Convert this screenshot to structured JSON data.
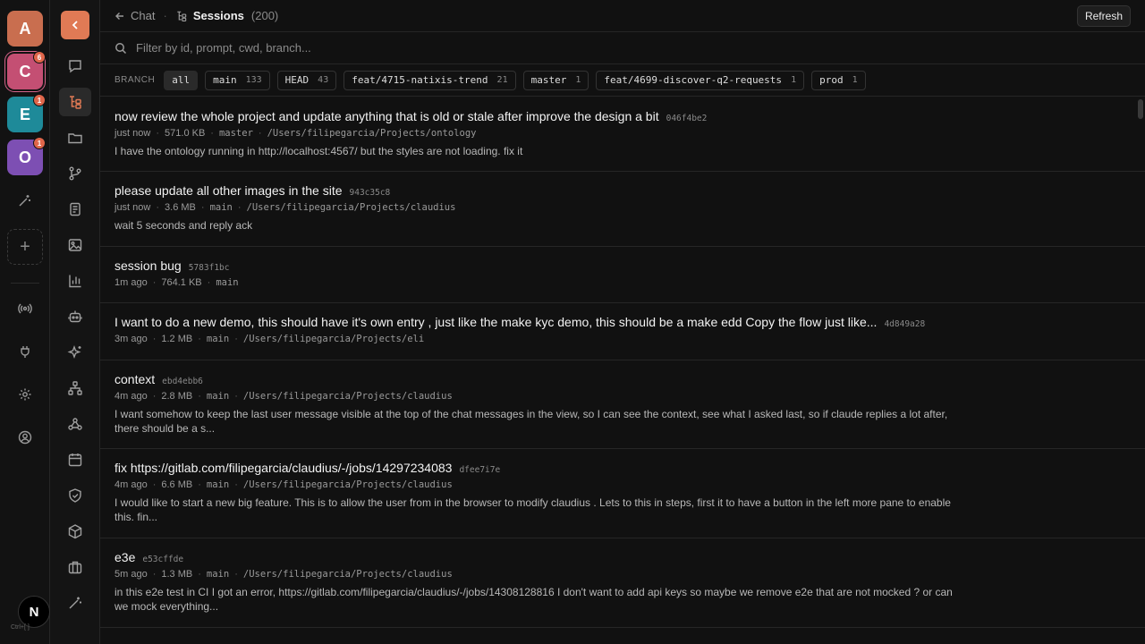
{
  "workspaces": [
    {
      "letter": "A",
      "color": "#c96e4f",
      "badge": ""
    },
    {
      "letter": "C",
      "color": "#c44f73",
      "badge": "6"
    },
    {
      "letter": "E",
      "color": "#1e8a99",
      "badge": "1"
    },
    {
      "letter": "O",
      "color": "#7d4fb3",
      "badge": "1"
    }
  ],
  "footer": {
    "avatar": "N",
    "shortcut": "Ctrl+[ ]"
  },
  "header": {
    "back_label": "Chat",
    "title": "Sessions",
    "count": "(200)",
    "refresh_label": "Refresh"
  },
  "filter": {
    "placeholder": "Filter by id, prompt, cwd, branch..."
  },
  "branches": {
    "label": "BRANCH",
    "chips": [
      {
        "name": "all",
        "count": ""
      },
      {
        "name": "main",
        "count": "133"
      },
      {
        "name": "HEAD",
        "count": "43"
      },
      {
        "name": "feat/4715-natixis-trend",
        "count": "21"
      },
      {
        "name": "master",
        "count": "1"
      },
      {
        "name": "feat/4699-discover-q2-requests",
        "count": "1"
      },
      {
        "name": "prod",
        "count": "1"
      }
    ]
  },
  "sessions": [
    {
      "title": "now review the whole project and update anything that is old or stale after improve the design a bit",
      "id": "046f4be2",
      "time": "just now",
      "size": "571.0 KB",
      "branch": "master",
      "cwd": "/Users/filipegarcia/Projects/ontology",
      "prompt": "I have the ontology running in http://localhost:4567/ but the styles are not loading. fix it"
    },
    {
      "title": "please update all other images in the site",
      "id": "943c35c8",
      "time": "just now",
      "size": "3.6 MB",
      "branch": "main",
      "cwd": "/Users/filipegarcia/Projects/claudius",
      "prompt": "wait 5 seconds and reply ack"
    },
    {
      "title": "session bug",
      "id": "5783f1bc",
      "time": "1m ago",
      "size": "764.1 KB",
      "branch": "main",
      "cwd": "",
      "prompt": ""
    },
    {
      "title": "I want to do a new demo, this should have it's own entry , just like the make kyc demo, this should be a make edd Copy the flow just like...",
      "id": "4d849a28",
      "time": "3m ago",
      "size": "1.2 MB",
      "branch": "main",
      "cwd": "/Users/filipegarcia/Projects/eli",
      "prompt": ""
    },
    {
      "title": "context",
      "id": "ebd4ebb6",
      "time": "4m ago",
      "size": "2.8 MB",
      "branch": "main",
      "cwd": "/Users/filipegarcia/Projects/claudius",
      "prompt": "I want somehow to keep the last user message visible at the top of the chat messages in the view, so I can see the context, see what I asked last, so if claude replies a lot after, there should be a s..."
    },
    {
      "title": "fix https://gitlab.com/filipegarcia/claudius/-/jobs/14297234083",
      "id": "dfee7i7e",
      "time": "4m ago",
      "size": "6.6 MB",
      "branch": "main",
      "cwd": "/Users/filipegarcia/Projects/claudius",
      "prompt": "I would like to start a new big feature. This is to allow the user from in the browser to modify claudius . Lets to this in steps, first it to have a button in the left more pane to enable this. fin..."
    },
    {
      "title": "e3e",
      "id": "e53cffde",
      "time": "5m ago",
      "size": "1.3 MB",
      "branch": "main",
      "cwd": "/Users/filipegarcia/Projects/claudius",
      "prompt": "in this e2e test in CI I got an error, https://gitlab.com/filipegarcia/claudius/-/jobs/14308128816 I don't want to add api keys so maybe we remove e2e that are not mocked ? or can we mock everything..."
    }
  ]
}
